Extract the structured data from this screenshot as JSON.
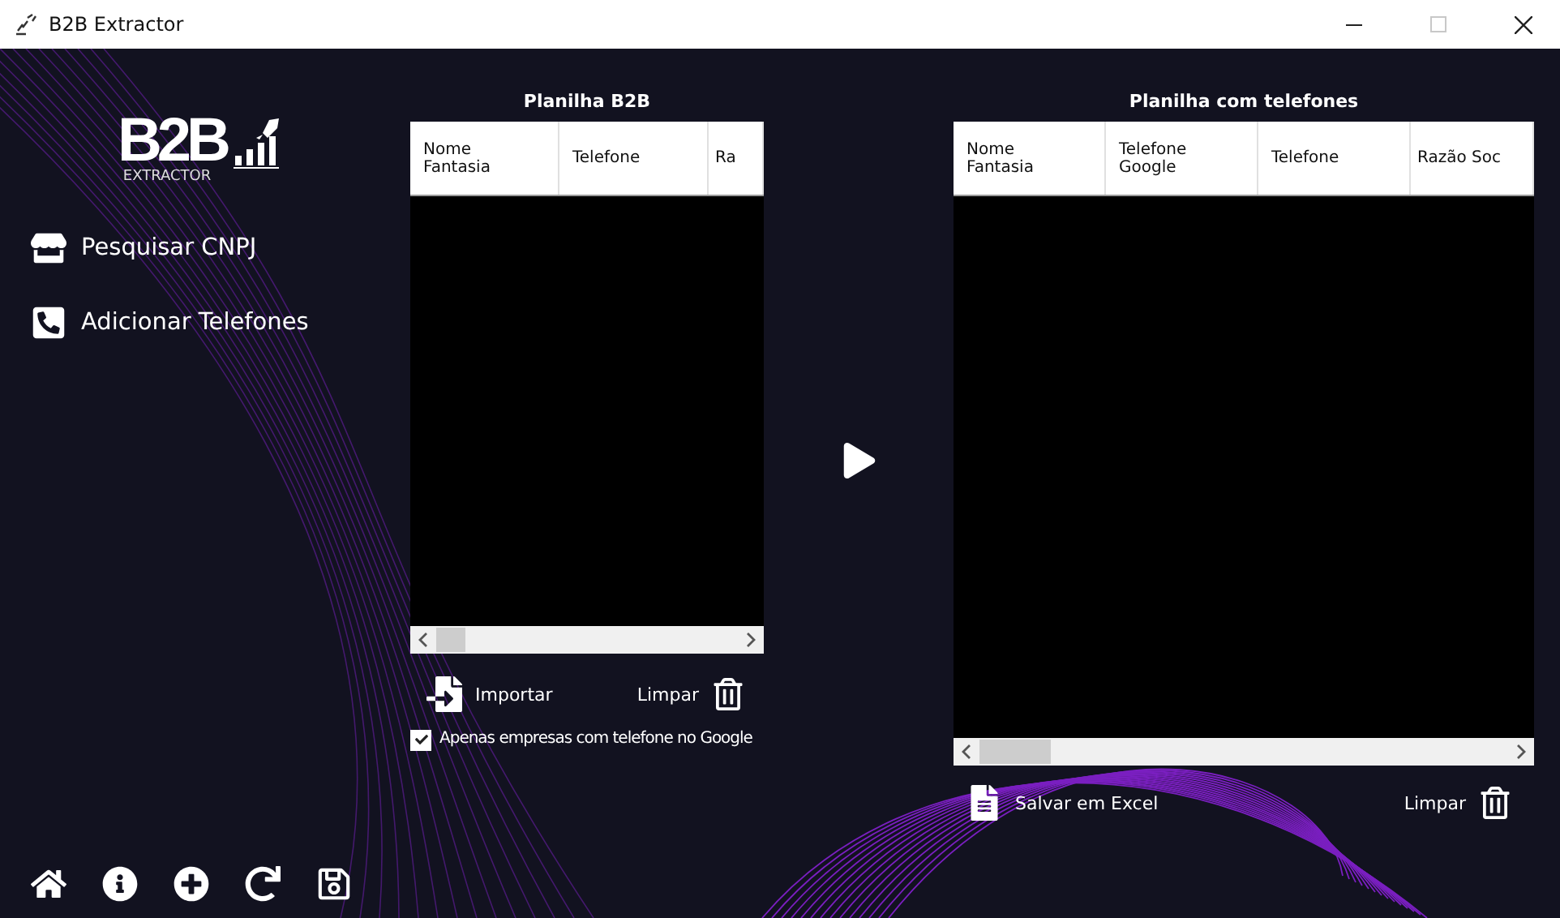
{
  "window": {
    "title": "B2B Extractor"
  },
  "logo": {
    "mark": "B2B",
    "subtitle": "EXTRACTOR"
  },
  "nav": [
    {
      "kind": "store",
      "label": "Pesquisar CNPJ"
    },
    {
      "kind": "phone",
      "label": "Adicionar Telefones"
    }
  ],
  "toolbar": [
    {
      "kind": "home"
    },
    {
      "kind": "info"
    },
    {
      "kind": "add"
    },
    {
      "kind": "refresh"
    },
    {
      "kind": "save"
    }
  ],
  "left_panel": {
    "title": "Planilha B2B",
    "columns": [
      "Nome Fantasia",
      "Telefone",
      "Ra"
    ],
    "import_label": "Importar",
    "clear_label": "Limpar",
    "filter": {
      "label": "Apenas empresas com telefone no Google",
      "checked": true
    }
  },
  "right_panel": {
    "title": "Planilha com telefones",
    "columns": [
      "Nome Fantasia",
      "Telefone Google",
      "Telefone",
      "Razão Soc"
    ],
    "save_label": "Salvar em Excel",
    "clear_label": "Limpar"
  }
}
